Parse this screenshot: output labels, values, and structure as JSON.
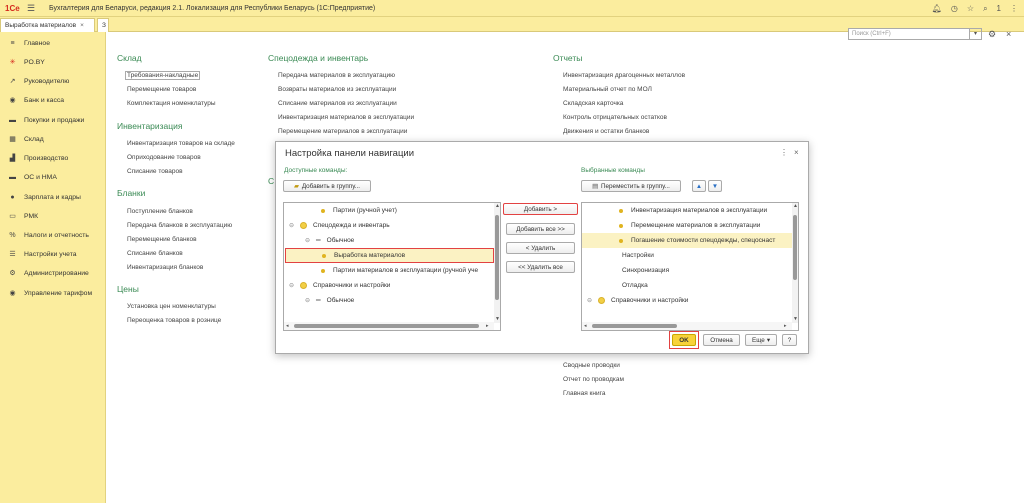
{
  "titlebar": {
    "logo": "1Се",
    "title": "Бухгалтерия для Беларуси, редакция 2.1. Локализация для Республики Беларусь (1С:Предприятие)",
    "page_num": "1"
  },
  "tabs": [
    {
      "label": "Выработка материалов",
      "close": "×"
    },
    {
      "label": "З"
    }
  ],
  "sidebar": {
    "items": [
      {
        "label": "Главное",
        "icon": "menu-icon"
      },
      {
        "label": "PO.BY",
        "icon": "star-icon"
      },
      {
        "label": "Руководителю",
        "icon": "chart-icon"
      },
      {
        "label": "Банк и касса",
        "icon": "bank-icon"
      },
      {
        "label": "Покупки и продажи",
        "icon": "cart-icon"
      },
      {
        "label": "Склад",
        "icon": "warehouse-icon"
      },
      {
        "label": "Производство",
        "icon": "factory-icon"
      },
      {
        "label": "ОС и НМА",
        "icon": "assets-icon"
      },
      {
        "label": "Зарплата и кадры",
        "icon": "person-icon"
      },
      {
        "label": "РМК",
        "icon": "pos-icon"
      },
      {
        "label": "Налоги и отчетность",
        "icon": "percent-icon"
      },
      {
        "label": "Настройки учета",
        "icon": "settings-list-icon"
      },
      {
        "label": "Администрирование",
        "icon": "gear-icon"
      },
      {
        "label": "Управление тарифом",
        "icon": "tariff-icon"
      }
    ]
  },
  "search": {
    "placeholder": "Поиск (Ctrl+F)"
  },
  "sections": {
    "sklad": {
      "title": "Склад",
      "links": [
        "Требования-накладные",
        "Перемещение товаров",
        "Комплектация номенклатуры"
      ]
    },
    "inventory": {
      "title": "Инвентаризация",
      "links": [
        "Инвентаризация товаров на складе",
        "Оприходование товаров",
        "Списание товаров"
      ]
    },
    "blanks": {
      "title": "Бланки",
      "links": [
        "Поступление бланков",
        "Передача бланков в эксплуатацию",
        "Перемещение бланков",
        "Списание бланков",
        "Инвентаризация бланков"
      ]
    },
    "prices": {
      "title": "Цены",
      "links": [
        "Установка цен номенклатуры",
        "Переоценка товаров в рознице"
      ]
    },
    "workwear": {
      "title": "Спецодежда и инвентарь",
      "links": [
        "Передача материалов в эксплуатацию",
        "Возвраты материалов из эксплуатации",
        "Списание материалов из эксплуатации",
        "Инвентаризация материалов в эксплуатации",
        "Перемещение материалов в эксплуатации"
      ],
      "partial": "С"
    },
    "reports": {
      "title": "Отчеты",
      "links_top": [
        "Инвентаризация драгоценных металлов",
        "Материальный отчет по МОЛ",
        "Складская карточка",
        "Контроль отрицательных остатков",
        "Движения и остатки бланков"
      ],
      "links_bottom": [
        "Сводные проводки",
        "Отчет по проводкам",
        "Главная книга"
      ]
    }
  },
  "dialog": {
    "title": "Настройка панели навигации",
    "available_label": "Доступные команды:",
    "selected_label": "Выбранные команды",
    "add_to_group": "Добавить в группу...",
    "move_to_group": "Переместить в группу...",
    "btn_add": "Добавить >",
    "btn_add_all": "Добавить все >>",
    "btn_remove": "< Удалить",
    "btn_remove_all": "<< Удалить все",
    "btn_ok": "OK",
    "btn_cancel": "Отмена",
    "btn_more": "Еще",
    "btn_help": "?",
    "available_items": [
      "Партии (ручной учет)",
      "Спецодежда и инвентарь",
      "Обычное",
      "Выработка материалов",
      "Партии материалов в эксплуатации (ручной уче",
      "Справочники и настройки",
      "Обычное"
    ],
    "selected_items": [
      "Инвентаризация материалов в эксплуатации",
      "Перемещение материалов в эксплуатации",
      "Погашение стоимости спецодежды, спецоснаст",
      "Настройки",
      "Синхронизация",
      "Отладка",
      "Справочники и настройки"
    ]
  }
}
